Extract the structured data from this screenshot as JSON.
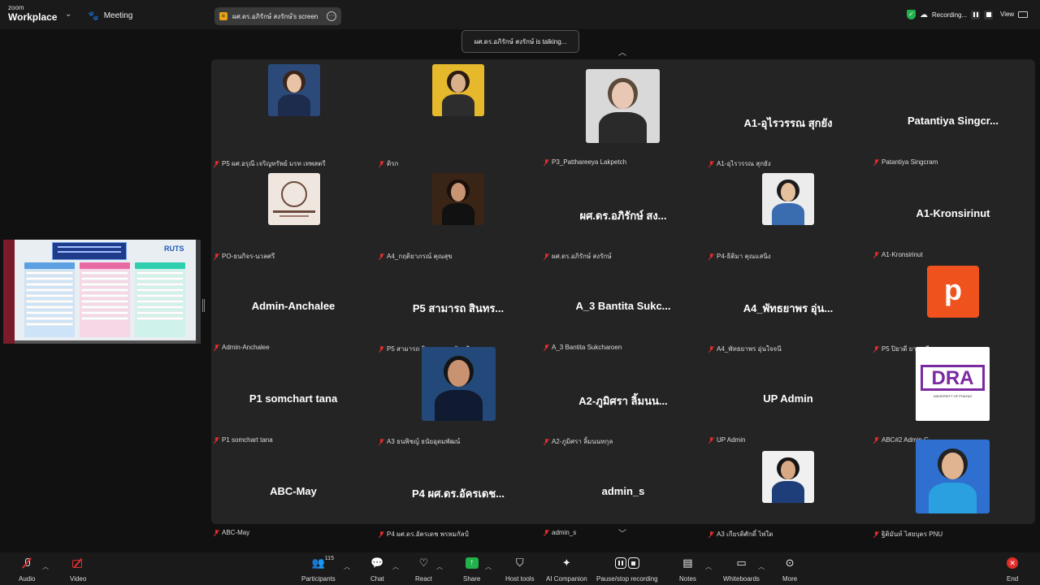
{
  "brand": {
    "small": "zoom",
    "big": "Workplace"
  },
  "meeting": {
    "label": "Meeting"
  },
  "share_pill": {
    "label": "ผศ.ดร.อภิรักษ์ สงรักษ์'s screen"
  },
  "recording": {
    "label": "Recording..."
  },
  "view": {
    "label": "View"
  },
  "talking": {
    "label": "ผศ.ดร.อภิรักษ์ สงรักษ์ is talking..."
  },
  "shared_screen": {
    "logo": "RUTS"
  },
  "tiles": [
    {
      "big": "",
      "label": "P5 ผศ.อรุณี เจริญทรัพย์ มรท เทพสตรี",
      "kind": "photo"
    },
    {
      "big": "",
      "label": "ติรก",
      "kind": "photo"
    },
    {
      "big": "",
      "label": "P3_Patthareeya Lakpetch",
      "kind": "video"
    },
    {
      "big": "A1-อุไรวรรณ สุกยัง",
      "label": "A1-อุไรวรรณ สุกยัง",
      "kind": "name"
    },
    {
      "big": "Patantiya Singcr...",
      "label": "Patantiya Singcram",
      "kind": "name"
    },
    {
      "big": "",
      "label": "PO-ธนกิจร-นวลศรี",
      "kind": "logo"
    },
    {
      "big": "",
      "label": "A4_กฤติยาภรณ์ คุณสุข",
      "kind": "photo"
    },
    {
      "big": "ผศ.ดร.อภิรักษ์ สง...",
      "label": "ผศ.ดร.อภิรักษ์ สงรักษ์",
      "kind": "name"
    },
    {
      "big": "",
      "label": "P4-ธิติมา คุณแสนิง",
      "kind": "photo"
    },
    {
      "big": "A1-Kronsirinut",
      "label": "A1-Kronsirinut",
      "kind": "name"
    },
    {
      "big": "Admin-Anchalee",
      "label": "Admin-Anchalee",
      "kind": "name"
    },
    {
      "big": "P5 สามารถ สินทร...",
      "label": "P5 สามารถ สินพร มรภ.ชัยภูมิ",
      "kind": "name"
    },
    {
      "big": "A_3 Bantita Sukc...",
      "label": "A_3 Bantita Sukcharoen",
      "kind": "name"
    },
    {
      "big": "A4_พัทธยาพร อุ่น...",
      "label": "A4_พัทธยาพร อุ่นใจจนี",
      "kind": "name"
    },
    {
      "big": "p",
      "label": "P5 ปิยวดี ยานุพดี",
      "kind": "letter"
    },
    {
      "big": "P1 somchart tana",
      "label": "P1 somchart tana",
      "kind": "name"
    },
    {
      "big": "",
      "label": "A3 ธนพิชญ์ ธนัยอุดมพัฒน์",
      "kind": "video"
    },
    {
      "big": "A2-ภูมิศรา ลิ้มนน...",
      "label": "A2-ภูมิศรา ลิ้มนนทกุล",
      "kind": "name"
    },
    {
      "big": "UP Admin",
      "label": "UP Admin",
      "kind": "name"
    },
    {
      "big": "",
      "label": "ABC#2 Admin G",
      "kind": "dra"
    },
    {
      "big": "ABC-May",
      "label": "ABC-May",
      "kind": "name"
    },
    {
      "big": "P4 ผศ.ดร.อัครเดช...",
      "label": "P4 ผศ.ดร.อัครเดช พรหมกัลป์",
      "kind": "name"
    },
    {
      "big": "admin_s",
      "label": "admin_s",
      "kind": "name"
    },
    {
      "big": "",
      "label": "A3 เกียรติศักดิ์ ไพ่ใด",
      "kind": "photo"
    },
    {
      "big": "",
      "label": "ฐิติมันท์ ไสยบุตร PNU",
      "kind": "video"
    }
  ],
  "dra": {
    "text": "DRA",
    "sub": "UNIVERSITY OF PHAYAO"
  },
  "toolbar": {
    "audio": "Audio",
    "video": "Video",
    "participants": "Participants",
    "participants_count": "115",
    "chat": "Chat",
    "react": "React",
    "share": "Share",
    "host_tools": "Host tools",
    "ai_companion": "AI Companion",
    "record": "Pause/stop recording",
    "notes": "Notes",
    "whiteboards": "Whiteboards",
    "more": "More",
    "end": "End"
  },
  "colors": {
    "accent_share": "#22b14c",
    "end": "#e02d2d",
    "mute": "#e02d2d",
    "letter_tile": "#f0521d"
  }
}
